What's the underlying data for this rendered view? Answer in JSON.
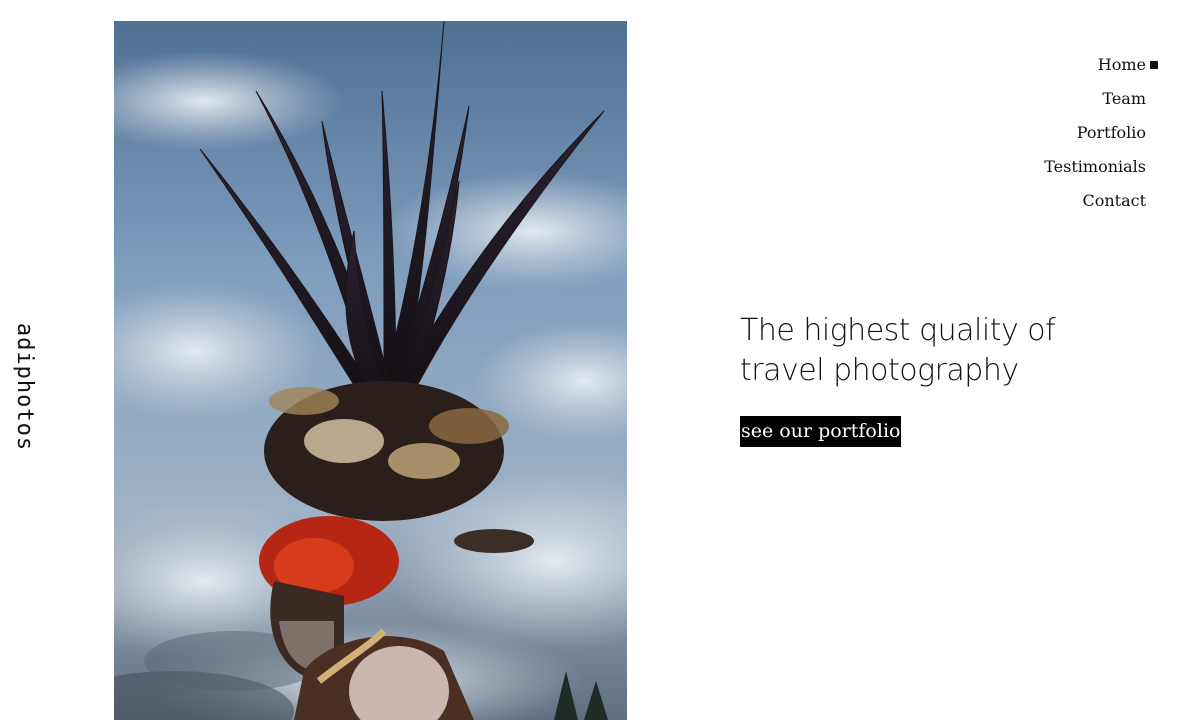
{
  "logo": {
    "text": "adiphotos"
  },
  "hero": {
    "description_icon": "hero-photo"
  },
  "nav": {
    "items": [
      {
        "label": "Home",
        "active": true
      },
      {
        "label": "Team",
        "active": false
      },
      {
        "label": "Portfolio",
        "active": false
      },
      {
        "label": "Testimonials",
        "active": false
      },
      {
        "label": "Contact",
        "active": false
      }
    ]
  },
  "headline": {
    "line1": "The highest quality of",
    "line2": "travel photography"
  },
  "cta": {
    "label": "see our portfolio"
  },
  "colors": {
    "background": "#ffffff",
    "text": "#111111",
    "cta_background": "#000000",
    "cta_text": "#ffffff"
  }
}
